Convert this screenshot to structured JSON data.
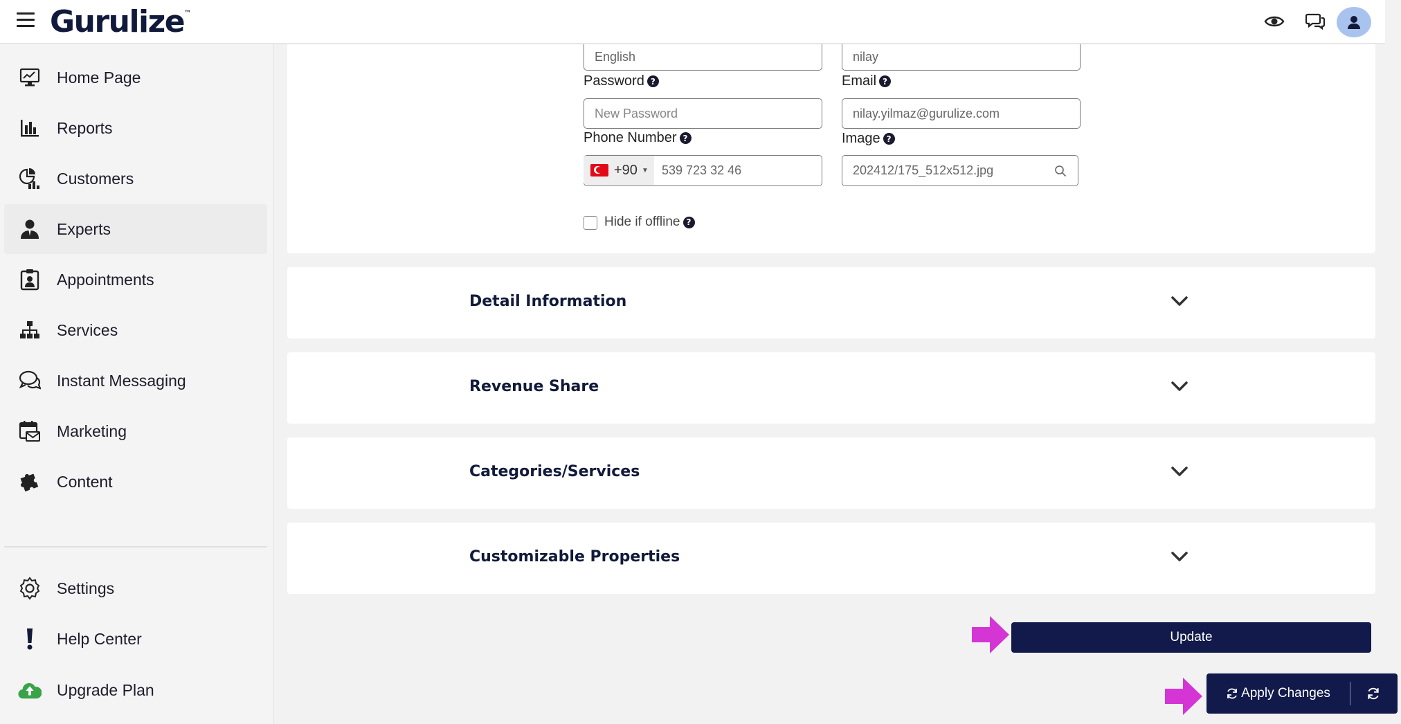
{
  "app": {
    "logo_text": "Gurulize",
    "logo_mark": "™"
  },
  "topbar": {
    "icons": [
      "menu-icon",
      "eye-icon",
      "chat-icon",
      "user-icon"
    ]
  },
  "sidebar": {
    "items": [
      {
        "label": "Home Page",
        "icon": "monitor-chart-icon"
      },
      {
        "label": "Reports",
        "icon": "bar-chart-icon"
      },
      {
        "label": "Customers",
        "icon": "pie-chart-icon"
      },
      {
        "label": "Experts",
        "icon": "user-tie-icon"
      },
      {
        "label": "Appointments",
        "icon": "clipboard-user-icon"
      },
      {
        "label": "Services",
        "icon": "sitemap-icon"
      },
      {
        "label": "Instant Messaging",
        "icon": "chat-bubbles-icon"
      },
      {
        "label": "Marketing",
        "icon": "calendar-mail-icon"
      },
      {
        "label": "Content",
        "icon": "puzzle-icon"
      }
    ],
    "bottom_items": [
      {
        "label": "Settings",
        "icon": "gear-icon"
      },
      {
        "label": "Help Center",
        "icon": "exclamation-icon"
      },
      {
        "label": "Upgrade Plan",
        "icon": "upload-cloud-icon"
      }
    ],
    "active": "Experts"
  },
  "form": {
    "language_value": "English",
    "username_value": "nilay",
    "password_label": "Password",
    "password_placeholder": "New Password",
    "email_label": "Email",
    "email_value": "nilay.yilmaz@gurulize.com",
    "phone_label": "Phone Number",
    "phone_dial_code": "+90",
    "phone_value": "539 723 32 46",
    "image_label": "Image",
    "image_value": "202412/175_512x512.jpg",
    "hide_offline_label": "Hide if offline",
    "hide_offline_checked": false
  },
  "sections": [
    {
      "title": "Detail Information"
    },
    {
      "title": "Revenue Share"
    },
    {
      "title": "Categories/Services"
    },
    {
      "title": "Customizable Properties"
    }
  ],
  "actions": {
    "update_label": "Update",
    "apply_label": "Apply Changes"
  },
  "colors": {
    "brand_navy": "#111a4a",
    "annotation_arrow": "#d535d5",
    "avatar_bg": "#a8c3ee",
    "upgrade_icon": "#3aa34a"
  }
}
